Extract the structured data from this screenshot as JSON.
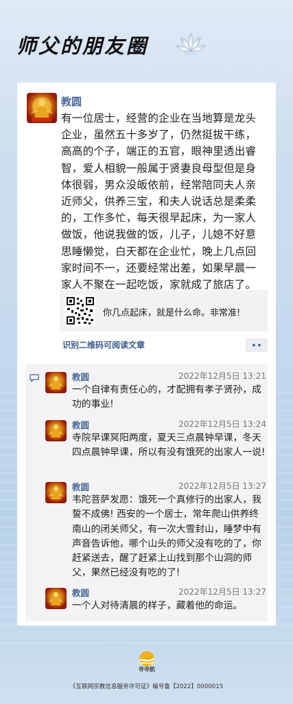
{
  "header": {
    "title": "师父的朋友圈",
    "lotus_icon": "lotus-icon"
  },
  "post": {
    "author": "教圆",
    "text": "有一位居士，经营的企业在当地算是龙头企业，虽然五十多岁了，仍然挺拔干练，高高的个子，端正的五官，眼神里透出睿智，爱人相貌一般属于贤妻良母型但是身体很弱，男众没皈依前，经常陪同夫人亲近师父，供养三宝，和夫人说话总是柔柔的，工作多忙，每天很早起床，为一家人做饭，他说我做的饭，儿子，儿媳不好意思睡懒觉，白天都在企业忙，晚上几点回家时间不一，还要经常出差，如果早晨一家人不聚在一起吃饭，家就成了旅店了。",
    "share_text": "你几点起床，就是什么命。非常准!",
    "qr_tip": "识别二维码可阅读文章",
    "more_icon": "more-dots-icon"
  },
  "comments": [
    {
      "author": "教圆",
      "time": "2022年12月5日 13:21",
      "text": "一个自律有责任心的，才配拥有孝子贤孙，成功的事业!"
    },
    {
      "author": "教圆",
      "time": "2022年12月5日 13:24",
      "text": "寺院早课冥阳两度，夏天三点晨钟早课，冬天四点晨钟早课，所以有没有饿死的出家人一说!"
    },
    {
      "author": "教圆",
      "time": "2022年12月5日 13:27",
      "text": "韦陀菩萨发愿：饿死一个真修行的出家人，我誓不成佛! 西安的一个居士，常年爬山供养终南山的闭关师父，有一次大雪封山，睡梦中有声音告诉他，哪个山头的师父没有吃的了，你赶紧送去，醒了赶紧上山找到那个山洞的师父，果然已经没有吃的了!"
    },
    {
      "author": "教圆",
      "time": "2022年12月5日 13:27",
      "text": "一个人对待清晨的样子，藏着他的命运。"
    }
  ],
  "footer": {
    "logo_text": "寺寺航",
    "license": "《互联网宗教信息服务许可证》编号鲁【2022】0000015"
  },
  "colors": {
    "link_blue": "#4e6b9a",
    "card_bg": "#ffffff",
    "comment_bg": "#f3f3f5"
  }
}
